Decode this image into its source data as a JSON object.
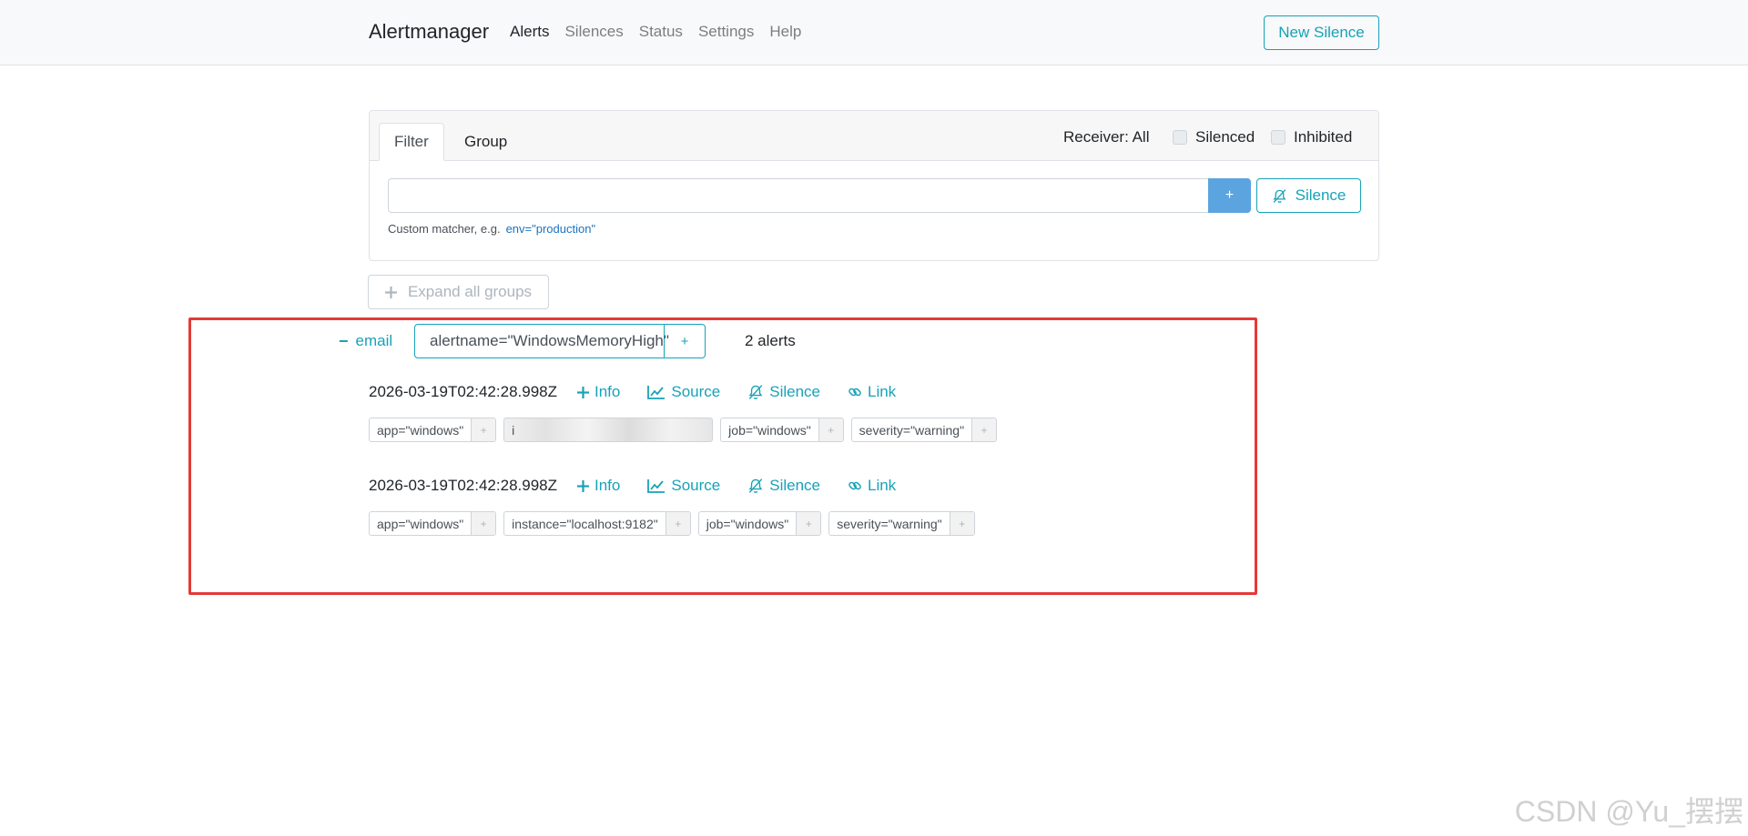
{
  "navbar": {
    "brand": "Alertmanager",
    "links": [
      "Alerts",
      "Silences",
      "Status",
      "Settings",
      "Help"
    ],
    "new_silence": "New Silence"
  },
  "filter": {
    "tabs": [
      "Filter",
      "Group"
    ],
    "receiver": "Receiver: All",
    "silenced": "Silenced",
    "inhibited": "Inhibited",
    "input_value": "",
    "add_button": "+",
    "silence_button": "Silence",
    "hint_prefix": "Custom matcher, e.g.",
    "hint_example": "env=\"production\""
  },
  "expand_all": "Expand all groups",
  "group": {
    "receiver": "email",
    "label": "alertname=\"WindowsMemoryHigh\"",
    "label_add": "+",
    "count": "2 alerts",
    "alerts": [
      {
        "timestamp": "2026-03-19T02:42:28.998Z",
        "actions": [
          "Info",
          "Source",
          "Silence",
          "Link"
        ],
        "labels": [
          "app=\"windows\"",
          "i",
          "job=\"windows\"",
          "severity=\"warning\""
        ]
      },
      {
        "timestamp": "2026-03-19T02:42:28.998Z",
        "actions": [
          "Info",
          "Source",
          "Silence",
          "Link"
        ],
        "labels": [
          "app=\"windows\"",
          "instance=\"localhost:9182\"",
          "job=\"windows\"",
          "severity=\"warning\""
        ]
      }
    ]
  },
  "watermark": "CSDN @Yu_摆摆",
  "colors": {
    "accent": "#17a2b8",
    "primary": "#5ba4e0",
    "highlight": "#e53935"
  }
}
